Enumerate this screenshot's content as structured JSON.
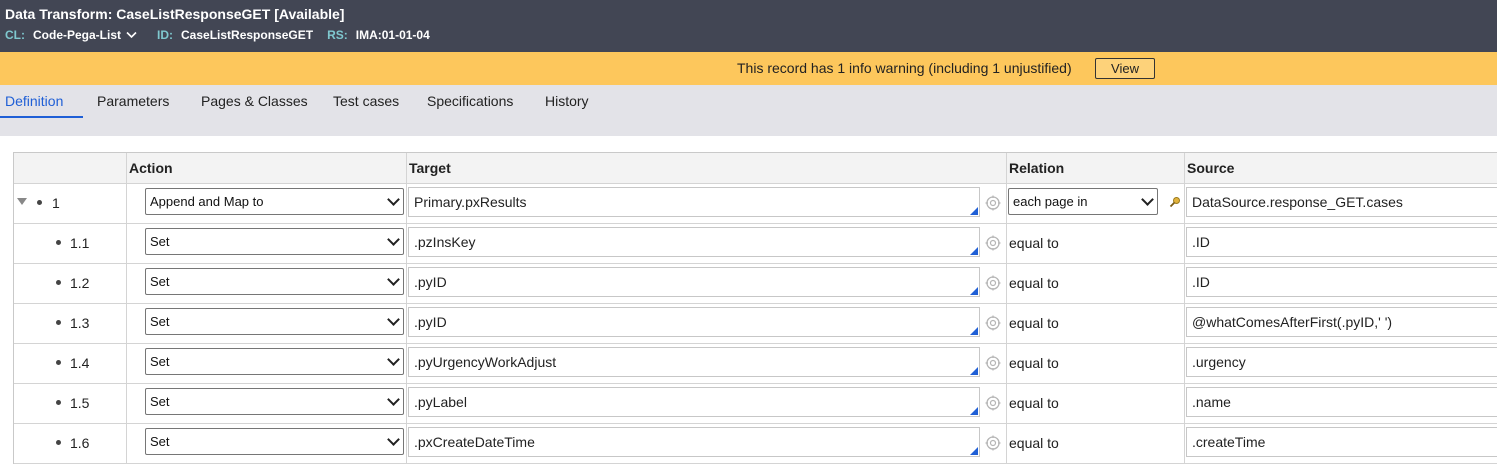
{
  "header": {
    "title": "Data Transform: CaseListResponseGET",
    "status": "[Available]",
    "cl_label": "CL:",
    "cl_value": "Code-Pega-List",
    "id_label": "ID:",
    "id_value": "CaseListResponseGET",
    "rs_label": "RS:",
    "rs_value": "IMA:01-01-04"
  },
  "warning": {
    "text": "This record has 1 info warning (including 1 unjustified)",
    "button": "View"
  },
  "tabs": [
    {
      "label": "Definition",
      "active": true
    },
    {
      "label": "Parameters",
      "active": false
    },
    {
      "label": "Pages & Classes",
      "active": false
    },
    {
      "label": "Test cases",
      "active": false
    },
    {
      "label": "Specifications",
      "active": false
    },
    {
      "label": "History",
      "active": false
    }
  ],
  "columns": {
    "action": "Action",
    "target": "Target",
    "relation": "Relation",
    "source": "Source"
  },
  "rows": [
    {
      "num": "1",
      "action": "Append and Map to",
      "target": "Primary.pxResults",
      "relation": "each page in",
      "source": "DataSource.response_GET.cases"
    },
    {
      "num": "1.1",
      "action": "Set",
      "target": ".pzInsKey",
      "relation": "equal to",
      "source": ".ID"
    },
    {
      "num": "1.2",
      "action": "Set",
      "target": ".pyID",
      "relation": "equal to",
      "source": ".ID"
    },
    {
      "num": "1.3",
      "action": "Set",
      "target": ".pyID",
      "relation": "equal to",
      "source": "@whatComesAfterFirst(.pyID,' ')"
    },
    {
      "num": "1.4",
      "action": "Set",
      "target": ".pyUrgencyWorkAdjust",
      "relation": "equal to",
      "source": ".urgency"
    },
    {
      "num": "1.5",
      "action": "Set",
      "target": ".pyLabel",
      "relation": "equal to",
      "source": ".name"
    },
    {
      "num": "1.6",
      "action": "Set",
      "target": ".pxCreateDateTime",
      "relation": "equal to",
      "source": ".createTime"
    }
  ],
  "colors": {
    "header_bg": "#424654",
    "warning_bg": "#fdc75c",
    "tab_active": "#1f5fd6",
    "label_teal": "#7fc8cf"
  }
}
